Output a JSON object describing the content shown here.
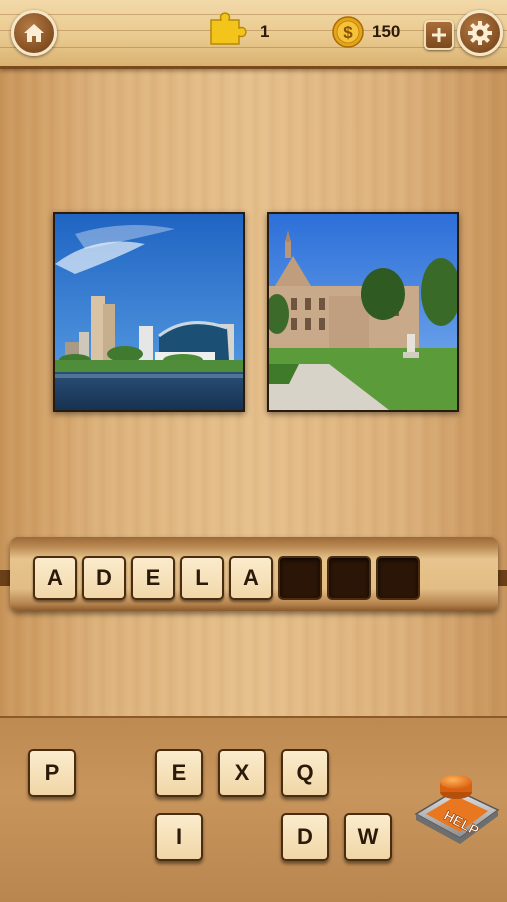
{
  "header": {
    "puzzle_count": "1",
    "coins": "150",
    "icons": {
      "home": "home-icon",
      "puzzle": "puzzle-piece-icon",
      "coin": "dollar-coin-icon",
      "add": "plus-icon",
      "settings": "gear-icon"
    }
  },
  "photos": [
    {
      "name": "city-skyline-river-photo"
    },
    {
      "name": "gothic-university-building-photo"
    }
  ],
  "answer": {
    "slots": [
      "A",
      "D",
      "E",
      "L",
      "A",
      "",
      "",
      ""
    ]
  },
  "letter_keys": {
    "row1": [
      {
        "letter": "P",
        "col": 0
      },
      {
        "letter": "E",
        "col": 2
      },
      {
        "letter": "X",
        "col": 3
      },
      {
        "letter": "Q",
        "col": 4
      }
    ],
    "row2": [
      {
        "letter": "I",
        "col": 2
      },
      {
        "letter": "D",
        "col": 4
      },
      {
        "letter": "W",
        "col": 5
      }
    ]
  },
  "help": {
    "label": "HELP"
  },
  "colors": {
    "wood_dark": "#7a4a1d",
    "tile": "#f3dcae",
    "slot_empty": "#2a1507",
    "help_orange": "#e8771f"
  }
}
